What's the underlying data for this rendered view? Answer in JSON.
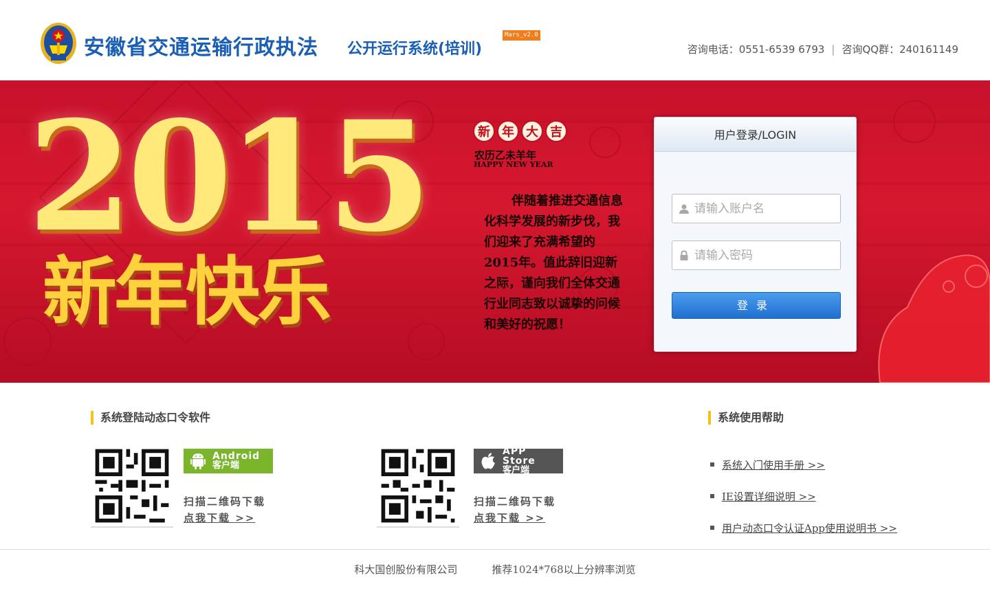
{
  "header": {
    "title_main": "安徽省交通运输行政执法",
    "title_sub": "公开运行系统(培训)",
    "version": "Mars_v2.0",
    "phone": "咨询电话：0551-6539 6793",
    "separator": "|",
    "qq": "咨询QQ群：240161149"
  },
  "banner": {
    "year": "2015",
    "greeting": "新年快乐",
    "seals": [
      "新",
      "年",
      "大",
      "吉"
    ],
    "lunar": "农历乙未羊年",
    "happy_new_year": "HAPPY NEW YEAR",
    "message": "伴随着推进交通信息化科学发展的新步伐，我们迎来了充满希望的2015年。值此辞旧迎新之际，谨向我们全体交通行业同志致以诚挚的问候和美好的祝愿！"
  },
  "login": {
    "title": "用户登录/LOGIN",
    "username_placeholder": "请输入账户名",
    "password_placeholder": "请输入密码",
    "submit_label": "登录"
  },
  "downloads": {
    "title": "系统登陆动态口令软件",
    "android": {
      "badge_line1": "Android",
      "badge_line2": "客户端",
      "scan": "扫描二维码下载",
      "link": "点我下载 >>"
    },
    "ios": {
      "badge_line1": "APP Store",
      "badge_line2": "客户端",
      "scan": "扫描二维码下载",
      "link": "点我下载 >>"
    }
  },
  "help": {
    "title": "系统使用帮助",
    "items": [
      "系统入门使用手册 >>",
      "IE设置详细说明 >>",
      "用户动态口令认证App使用说明书 >>"
    ]
  },
  "footer": {
    "company": "科大国创股份有限公司",
    "resolution": "推荐1024*768以上分辨率浏览"
  },
  "colors": {
    "brand_blue": "#1a5fb4",
    "banner_red": "#d6182f",
    "accent_yellow": "#f0c419",
    "android_green": "#7ab52b",
    "button_blue": "#2f84dd"
  }
}
